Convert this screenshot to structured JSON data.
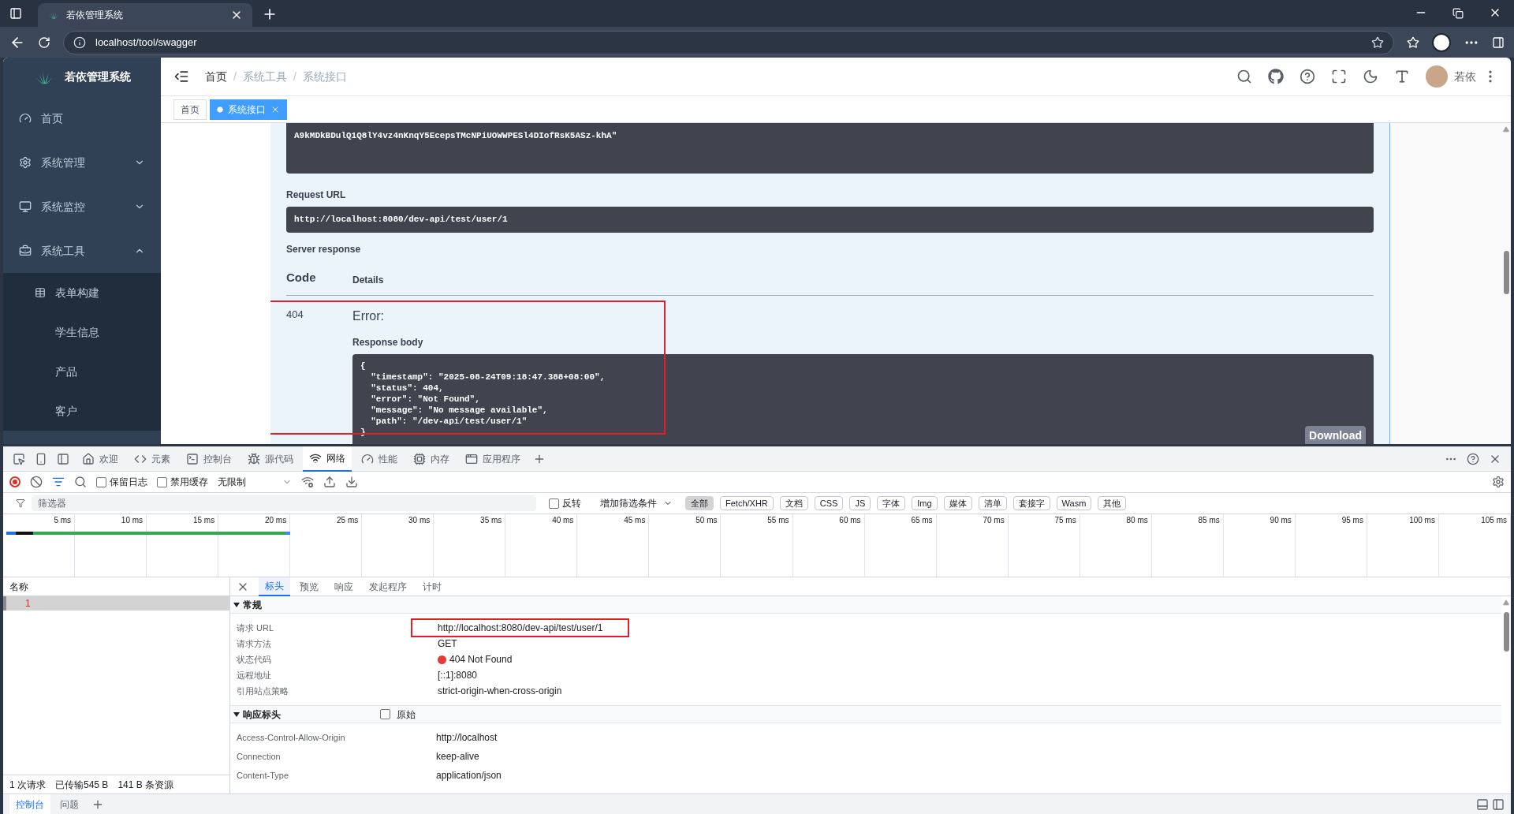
{
  "browser": {
    "tab_title": "若依管理系统",
    "address": "localhost/tool/swagger"
  },
  "sidebar": {
    "logo": "若依管理系统",
    "items": [
      {
        "label": "首页",
        "kind": "link"
      },
      {
        "label": "系统管理",
        "kind": "submenu",
        "expanded": false
      },
      {
        "label": "系统监控",
        "kind": "submenu",
        "expanded": false
      },
      {
        "label": "系统工具",
        "kind": "submenu",
        "expanded": true,
        "children": [
          {
            "label": "表单构建"
          },
          {
            "label": "学生信息"
          },
          {
            "label": "产品"
          },
          {
            "label": "客户"
          }
        ]
      }
    ]
  },
  "header": {
    "breadcrumb": [
      "首页",
      "系统工具",
      "系统接口"
    ],
    "separator": "/",
    "user": "若依"
  },
  "tags": [
    {
      "label": "首页",
      "selected": false
    },
    {
      "label": "系统接口",
      "selected": true
    }
  ],
  "swagger": {
    "curl_tail": "A9kMDkBDulQ1Q8lY4vz4nKnqY5EcepsTMcNPiUOWWPESl4DIofRsK5ASz-khA\"",
    "request_url_label": "Request URL",
    "request_url": "http://localhost:8080/dev-api/test/user/1",
    "server_response_label": "Server response",
    "columns": [
      "Code",
      "Details"
    ],
    "code": "404",
    "error": "Error:",
    "body_label": "Response body",
    "highlighted": true,
    "body_lines": [
      "{",
      "  \"timestamp\": \"2025-08-24T09:18:47.388+08:00\",",
      "  \"status\": 404,",
      "  \"error\": \"Not Found\",",
      "  \"message\": \"No message available\",",
      "  \"path\": \"/dev-api/test/user/1\"",
      "}"
    ],
    "download": "Download"
  },
  "devtools": {
    "tabs": [
      {
        "label": "欢迎",
        "selected": false
      },
      {
        "label": "元素",
        "selected": false
      },
      {
        "label": "控制台",
        "selected": false
      },
      {
        "label": "源代码",
        "selected": false
      },
      {
        "label": "网络",
        "selected": true
      },
      {
        "label": "性能",
        "selected": false
      },
      {
        "label": "内存",
        "selected": false
      },
      {
        "label": "应用程序",
        "selected": false
      }
    ],
    "options": [
      {
        "label": "保留日志",
        "checked": false
      },
      {
        "label": "禁用缓存",
        "checked": false
      }
    ],
    "throttle": "无限制",
    "filter_placeholder": "筛选器",
    "invert": {
      "label": "反转",
      "checked": false
    },
    "more_filters": "增加筛选条件",
    "types": [
      {
        "label": "全部",
        "selected": true
      },
      {
        "label": "Fetch/XHR",
        "selected": false
      },
      {
        "label": "文档",
        "selected": false
      },
      {
        "label": "CSS",
        "selected": false
      },
      {
        "label": "JS",
        "selected": false
      },
      {
        "label": "字体",
        "selected": false
      },
      {
        "label": "Img",
        "selected": false
      },
      {
        "label": "媒体",
        "selected": false
      },
      {
        "label": "清单",
        "selected": false
      },
      {
        "label": "套接字",
        "selected": false
      },
      {
        "label": "Wasm",
        "selected": false
      },
      {
        "label": "其他",
        "selected": false
      }
    ],
    "timeline_ticks": [
      "5 ms",
      "10 ms",
      "15 ms",
      "20 ms",
      "25 ms",
      "30 ms",
      "35 ms",
      "40 ms",
      "45 ms",
      "50 ms",
      "55 ms",
      "60 ms",
      "65 ms",
      "70 ms",
      "75 ms",
      "80 ms",
      "85 ms",
      "90 ms",
      "95 ms",
      "100 ms",
      "105 ms"
    ],
    "list_header": "名称",
    "requests": [
      {
        "name": "1",
        "selected": true
      }
    ],
    "summary": [
      "1 次请求",
      "已传输545 B",
      "141 B 条资源"
    ],
    "detail_tabs": [
      {
        "label": "标头",
        "selected": true
      },
      {
        "label": "预览",
        "selected": false
      },
      {
        "label": "响应",
        "selected": false
      },
      {
        "label": "发起程序",
        "selected": false
      },
      {
        "label": "计时",
        "selected": false
      }
    ],
    "general": {
      "title": "常规",
      "expanded": true,
      "rows": [
        {
          "key": "请求 URL",
          "value": "http://localhost:8080/dev-api/test/user/1",
          "highlighted": true
        },
        {
          "key": "请求方法",
          "value": "GET"
        },
        {
          "key": "状态代码",
          "value": "404 Not Found",
          "color": "#e53935"
        },
        {
          "key": "远程地址",
          "value": "[::1]:8080"
        },
        {
          "key": "引用站点策略",
          "value": "strict-origin-when-cross-origin"
        }
      ]
    },
    "response_headers": {
      "title": "响应标头",
      "expanded": true,
      "raw": {
        "label": "原始",
        "checked": false
      },
      "rows": [
        {
          "key": "Access-Control-Allow-Origin",
          "value": "http://localhost"
        },
        {
          "key": "Connection",
          "value": "keep-alive"
        },
        {
          "key": "Content-Type",
          "value": "application/json"
        }
      ]
    },
    "drawer_tabs": [
      {
        "label": "控制台",
        "selected": true
      },
      {
        "label": "问题",
        "selected": false
      }
    ]
  }
}
